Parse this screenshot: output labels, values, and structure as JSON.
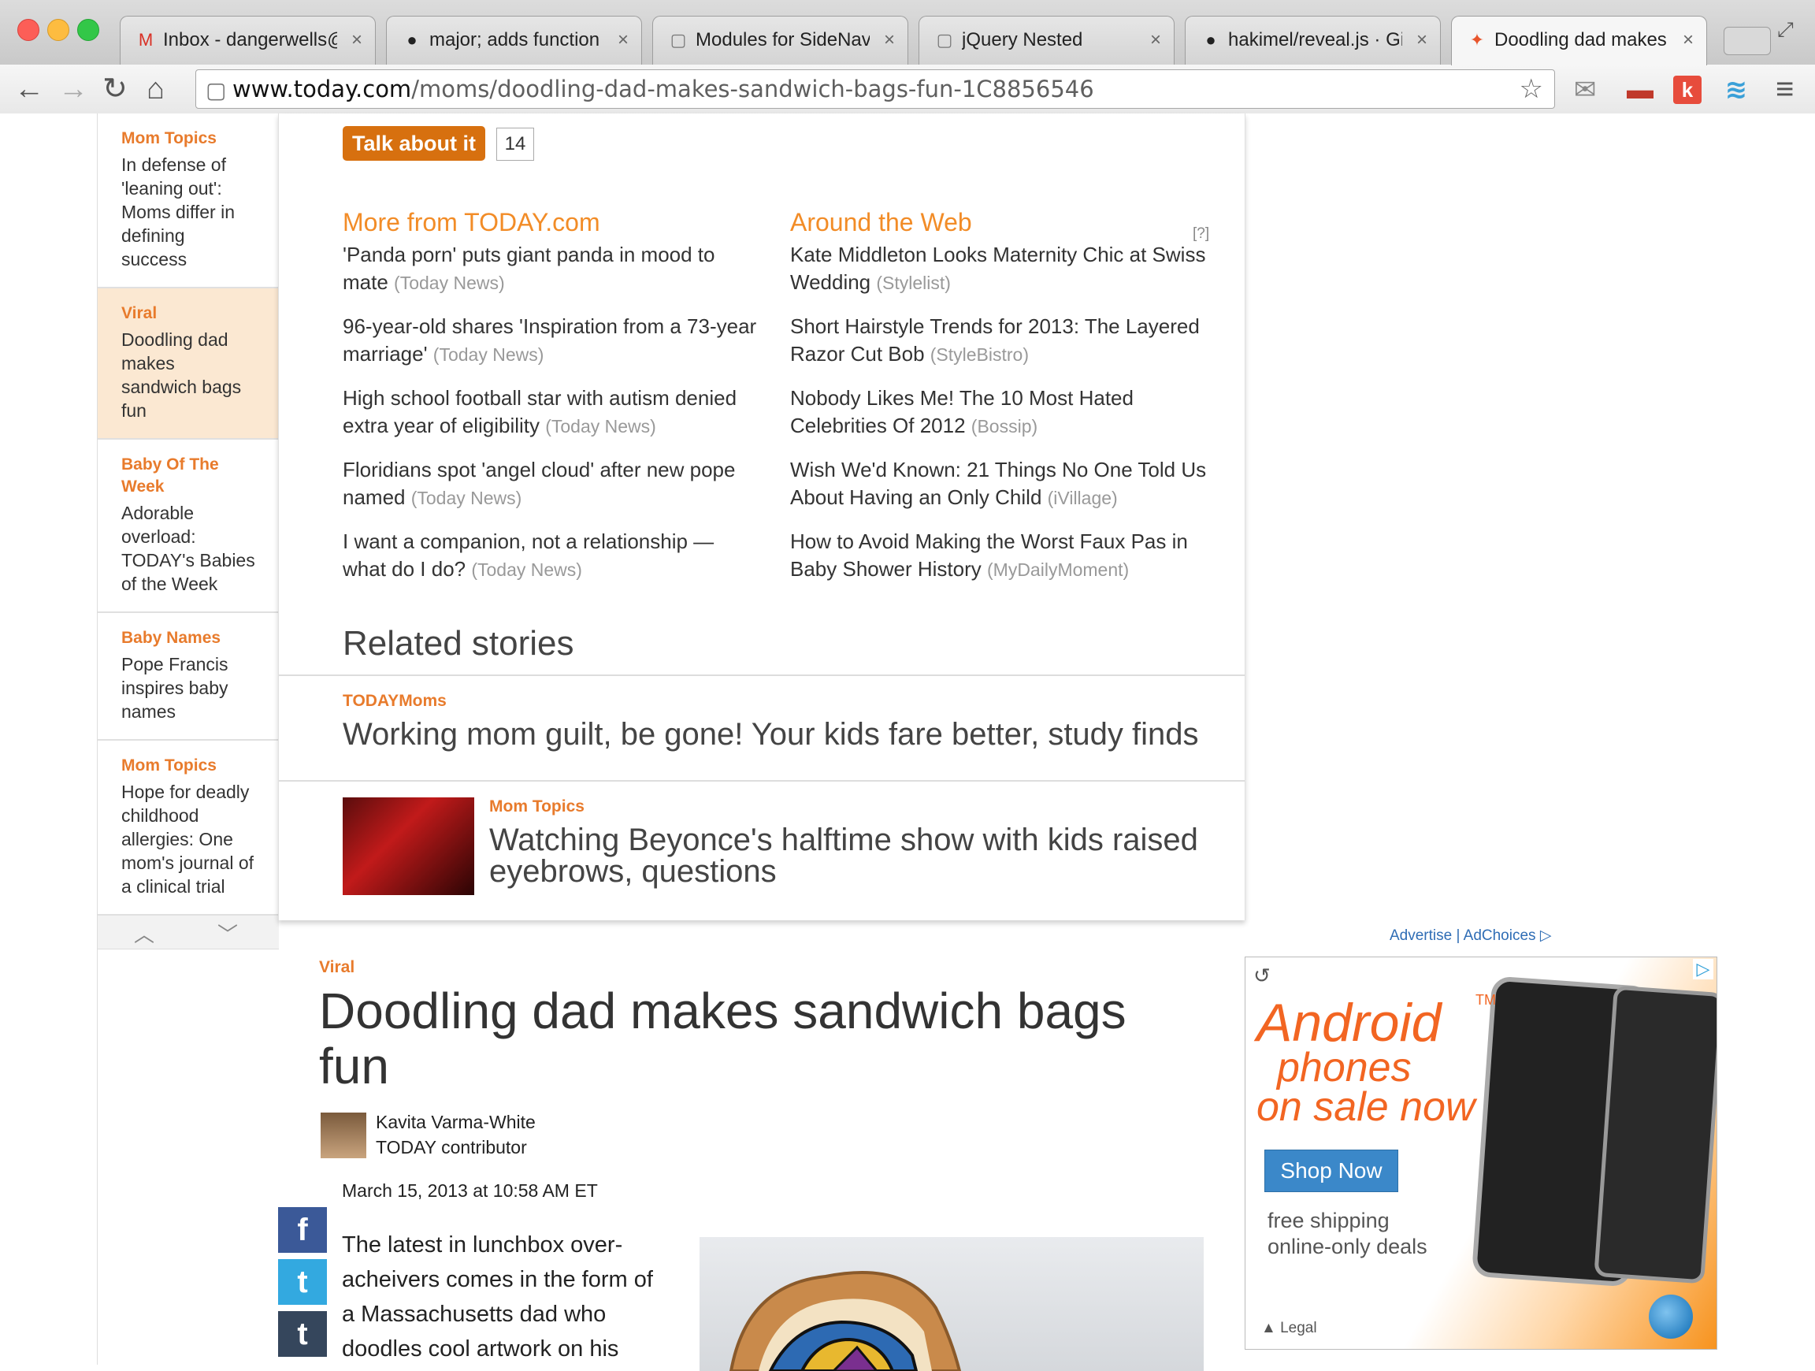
{
  "browser": {
    "tabs": [
      {
        "icon": "gmail-icon",
        "glyph": "M",
        "color": "#d93025",
        "title": "Inbox - dangerwells@"
      },
      {
        "icon": "github-icon",
        "glyph": "●",
        "color": "#222",
        "title": "major; adds function"
      },
      {
        "icon": "page-icon",
        "glyph": "▢",
        "color": "#777",
        "title": "Modules for SideNav"
      },
      {
        "icon": "page-icon",
        "glyph": "▢",
        "color": "#777",
        "title": "jQuery Nested"
      },
      {
        "icon": "github-icon",
        "glyph": "●",
        "color": "#222",
        "title": "hakimel/reveal.js · Gi"
      },
      {
        "icon": "nbc-peacock-icon",
        "glyph": "✦",
        "color": "#e8552c",
        "title": "Doodling dad makes"
      }
    ],
    "close_glyph": "×",
    "url_host": "www.today.com",
    "url_path": "/moms/doodling-dad-makes-sandwich-bags-fun-1C8856546",
    "nav": {
      "back": "←",
      "forward": "→",
      "reload": "↻",
      "home": "⌂",
      "star": "☆",
      "menu": "≡"
    },
    "extensions": [
      {
        "name": "mail-extension-icon",
        "glyph": "✉",
        "color": "#888"
      },
      {
        "name": "couch-extension-icon",
        "glyph": "▬",
        "color": "#c0392b"
      },
      {
        "name": "klout-extension-icon",
        "glyph": "k",
        "color": "#e74c3c"
      },
      {
        "name": "wave-extension-icon",
        "glyph": "≋",
        "color": "#3aa0d8"
      }
    ]
  },
  "left_rail": {
    "items": [
      {
        "category": "Mom Topics",
        "title": "In defense of 'leaning out': Moms differ in defining success",
        "active": false
      },
      {
        "category": "Viral",
        "title": "Doodling dad makes sandwich bags fun",
        "active": true
      },
      {
        "category": "Baby Of The Week",
        "title": "Adorable overload: TODAY's Babies of the Week",
        "active": false
      },
      {
        "category": "Baby Names",
        "title": "Pope Francis inspires baby names",
        "active": false
      },
      {
        "category": "Mom Topics",
        "title": "Hope for deadly childhood allergies: One mom's journal of a clinical trial",
        "active": false
      }
    ],
    "arrow_up": "︿",
    "arrow_down": "﹀"
  },
  "discussion": {
    "talk_label": "Talk about it",
    "comment_count": "14"
  },
  "more_from": {
    "heading": "More from TODAY.com",
    "items": [
      {
        "title": "'Panda porn' puts giant panda in mood to mate",
        "source": "(Today News)"
      },
      {
        "title": "96-year-old shares 'Inspiration from a 73-year marriage'",
        "source": "(Today News)"
      },
      {
        "title": "High school football star with autism denied extra year of eligibility",
        "source": "(Today News)"
      },
      {
        "title": "Floridians spot 'angel cloud' after new pope named",
        "source": "(Today News)"
      },
      {
        "title": "I want a companion, not a relationship — what do I do?",
        "source": "(Today News)"
      }
    ]
  },
  "around_web": {
    "heading": "Around the Web",
    "info": "[?]",
    "items": [
      {
        "title": "Kate Middleton Looks Maternity Chic at Swiss Wedding",
        "source": "(Stylelist)"
      },
      {
        "title": "Short Hairstyle Trends for 2013: The Layered Razor Cut Bob",
        "source": "(StyleBistro)"
      },
      {
        "title": "Nobody Likes Me! The 10 Most Hated Celebrities Of 2012",
        "source": "(Bossip)"
      },
      {
        "title": "Wish We'd Known: 21 Things No One Told Us About Having an Only Child",
        "source": "(iVillage)"
      },
      {
        "title": "How to Avoid Making the Worst Faux Pas in Baby Shower History",
        "source": "(MyDailyMoment)"
      }
    ]
  },
  "related": {
    "heading": "Related stories",
    "stories": [
      {
        "category": "TODAYMoms",
        "title": "Working mom guilt, be gone! Your kids fare better, study finds"
      },
      {
        "category": "Mom Topics",
        "title": "Watching Beyonce's halftime show with kids raised eyebrows, questions"
      }
    ]
  },
  "article": {
    "category": "Viral",
    "title": "Doodling dad makes sandwich bags fun",
    "author_name": "Kavita Varma-White",
    "author_role": "TODAY contributor",
    "date": "March 15, 2013 at 10:58 AM ET",
    "body": "The latest in lunchbox over-acheivers comes in the form of a Massachusetts dad who doodles cool artwork on his",
    "share": [
      {
        "name": "facebook-share-button",
        "glyph": "f",
        "color": "#3b5998"
      },
      {
        "name": "twitter-share-button",
        "glyph": "t",
        "color": "#33a9e0"
      },
      {
        "name": "tumblr-share-button",
        "glyph": "t",
        "color": "#35465c"
      }
    ]
  },
  "ad": {
    "advertise": "Advertise",
    "separator": "|",
    "adchoices": "AdChoices ▷",
    "headline": "Android",
    "tm": "TM",
    "line2": "phones",
    "line3": "on sale now",
    "cta": "Shop Now",
    "shipping": "free shipping",
    "online": "online-only deals",
    "legal": "▲ Legal",
    "replay": "↺"
  }
}
